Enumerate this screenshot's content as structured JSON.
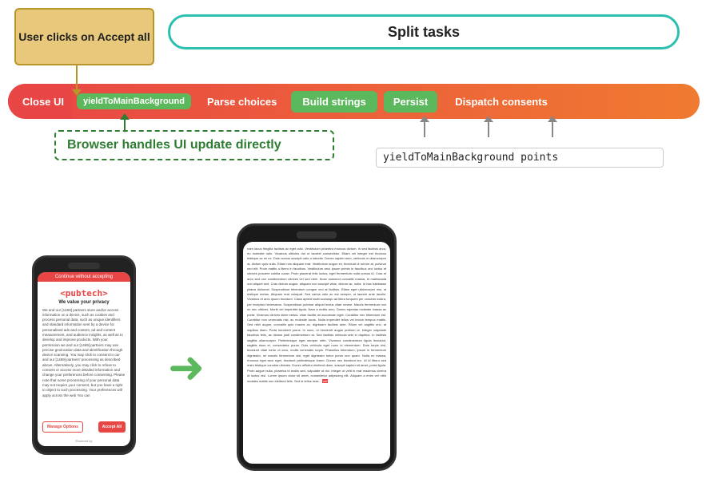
{
  "diagram": {
    "user_clicks_label": "User clicks on Accept all",
    "split_tasks_label": "Split tasks",
    "pipeline": {
      "close_ui": "Close UI",
      "yield1": "yieldToMainBackground",
      "parse_choices": "Parse choices",
      "build_strings": "Build strings",
      "persist": "Persist",
      "dispatch_consents": "Dispatch consents"
    },
    "browser_handles_label": "Browser handles UI update directly",
    "yield_points_label": "yieldToMainBackground  points"
  },
  "phone_left": {
    "banner": "Continue without accepting",
    "logo": "<pubtech>",
    "tagline": "We value your privacy",
    "body": "We and our [1469] partners store and/or access information on a device, such as cookies and process personal data, such as unique identifiers and standard information sent by a device for personalised ads and content, ad and content measurement, and audience insights, as well as to develop and improve products. With your permission we and our [1469] partners may use precise geolocation data and identification through device scanning. You may click to consent to our and our [1469] partners' processing as described above. Alternatively, you may click to refuse to consent or access more detailed information and change your preferences before consenting. Please note that some processing of your personal data may not require your consent, but you have a right to object to such processing. Your preferences will apply across the web You can",
    "manage_btn": "Manage Options",
    "accept_btn": "Accept All",
    "powered": "Powered by"
  },
  "phone_right": {
    "lorem": "nam lacus fringilla facilisis ac eget odio. Vestibulum pharetra rhoncus dictum. In sed facilisis arcu, eu molestie odio. Vivamus ultricies dui ut laoreet consectetur. Etiam vel integer est rhoncus tristique ac mi ex. Duis cursus suscipit odio a lobortis. Donec sapien sem, vehicula in ullamcorper at, dictum quis nulla. Etiam non aliquam erat. Vestibulum augue ex, tincidunt ut rutrum at, pulvinar sed elit. Proin mattis a libero in faucibus. Vestibulum arcu ipsum primis in faucibus orci luctus et ultrices posuere cubilia curae; Proin placerat felis luctus, eget fermentum nulla cursus id. Cras et arcu sed orci condimentum ultrices vel sed nibh. Nunc euismod convallis massa, id malesuada orci aliquet sed. Cras dictum augue, aliquam non suscipit vitae, dictum ac, nulla. In hac habitasse platea dictumst. Suspendisse bibendum congue orci at facilisis. Etiam eget ullamcorper nisl, ut tristique metus. Aliquam erat volutpat. Sed varius odio ac est semper, ut laoreet ante iaculis. Vivamus et arcu ipsum tincidunt. Class aptent taciti sociosqu ad litora torquent per conubia nostra, per inceptos himenaeos. Suspendisse pulvinar aliquet lectus vitae ornare. Mauris fermentum non ex nec ultrices. Morbi vel imperdiet ligula. Nam a mollis arcu. Donec egestas molestie massa ac porta. Vivamus ultrices diam metus, vitae facilisi mi accumsan eget. Curabitur nec bibendum est. Curabitur non venenatis nisl, ac molestie lacus. Nulla imperdiet tellus vel lectus tempus mattis. Sed nibh augue, convallis quis mauris ac, dignissim facilisis ante. Etiam vel sagittis orci, at dapibus diam. Porta hendrerit purus. In nunc, ut hendrerit augue pretium ut. Integer vulputate faucibus felis, ac dictum justi condimentum at. Sed facilisis vehicula arbi in dapibus. In facilisis sagittis ullamcorper. Pellentesque eget semper nibh. Vivamus condimentum ligula tincidunt, sagittis risus et, consectetur purus. Duis vehicula eget nunc id elementum. Duis turpis nisi, tincidunt vitae tortor ut arcu, mollis venenatis turpis. Phasellus bibendum, ipsum in fermentum dignissim, mi mauris fermentum nisl, eget dignissim tortor purus non quam. Nulla ex massa, rhoncus eget arcu eget, tincidunt pellentesque lorem. Donec nec tincidunt leo. Ut id libero sed enim tristique conubia ultricies. Donec efficitur eleifend diam, suscipit sapien sit amet, porta ligula. Proin augue nulla, pharetra id mollis sed, vulputate ut dui. Integer ut velit in erat maximus viverra id luctus nisl. Lorem ipsum dolor sit amet, consectetur adipiscing elit. Aliquam a enim vel nibh sodales mattis non eleifend felis. Sed id tellus mas..."
  },
  "arrow_label": "➜"
}
